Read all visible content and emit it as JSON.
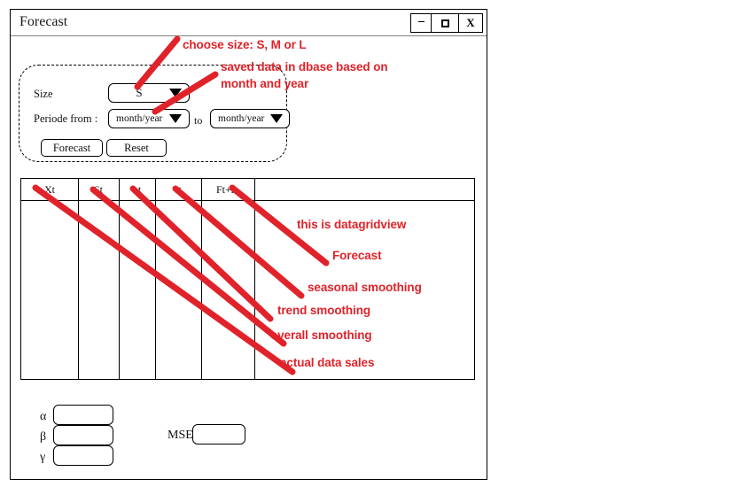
{
  "window": {
    "title": "Forecast",
    "controls": {
      "minimize": "-",
      "maximize": "□",
      "close": "X"
    }
  },
  "form": {
    "size_label": "Size",
    "size_value": "S",
    "periode_label": "Periode from :",
    "from_value": "month/year",
    "to_label": "to",
    "to_value": "month/year",
    "buttons": {
      "forecast": "Forecast",
      "reset": "Reset"
    }
  },
  "grid": {
    "columns": [
      "Xt",
      "St",
      "bt",
      "It",
      "Ft+m",
      ""
    ]
  },
  "parameters": {
    "alpha_label": "α",
    "alpha_value": "",
    "beta_label": "β",
    "beta_value": "",
    "gamma_label": "γ",
    "gamma_value": "",
    "mse_label": "MSE",
    "mse_value": ""
  },
  "annotations": {
    "choose_size": "choose size: S, M or L",
    "dbase_line1": "saved data in dbase based on",
    "dbase_line2": "month and year",
    "datagridview": "this is datagridview",
    "forecast": "Forecast",
    "seasonal": "seasonal smoothing",
    "trend": "trend smoothing",
    "overall": "overall smoothing",
    "actual": "actual data sales"
  },
  "colors": {
    "annotation_red": "#e0232a",
    "frame_black": "#000000",
    "background": "#ffffff"
  }
}
